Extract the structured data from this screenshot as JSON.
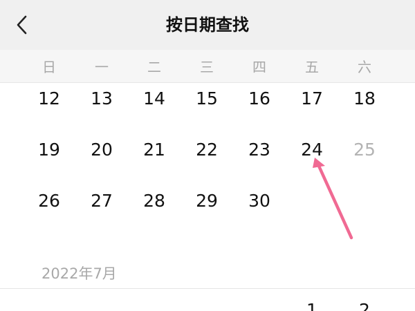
{
  "header": {
    "title": "按日期查找",
    "back_icon": "chevron-left-icon"
  },
  "weekdays": [
    "日",
    "一",
    "二",
    "三",
    "四",
    "五",
    "六"
  ],
  "calendar": {
    "rows": [
      [
        {
          "label": "12",
          "disabled": false
        },
        {
          "label": "13",
          "disabled": false
        },
        {
          "label": "14",
          "disabled": false
        },
        {
          "label": "15",
          "disabled": false
        },
        {
          "label": "16",
          "disabled": false
        },
        {
          "label": "17",
          "disabled": false
        },
        {
          "label": "18",
          "disabled": false
        }
      ],
      [
        {
          "label": "19",
          "disabled": false
        },
        {
          "label": "20",
          "disabled": false
        },
        {
          "label": "21",
          "disabled": false
        },
        {
          "label": "22",
          "disabled": false
        },
        {
          "label": "23",
          "disabled": false
        },
        {
          "label": "24",
          "disabled": false
        },
        {
          "label": "25",
          "disabled": true
        }
      ],
      [
        {
          "label": "26",
          "disabled": false
        },
        {
          "label": "27",
          "disabled": false
        },
        {
          "label": "28",
          "disabled": false
        },
        {
          "label": "29",
          "disabled": false
        },
        {
          "label": "30",
          "disabled": false
        }
      ]
    ]
  },
  "next_month": {
    "label": "2022年7月",
    "first_days": [
      "1",
      "2"
    ]
  },
  "annotation": {
    "points_to": "24",
    "color": "#f06a93"
  },
  "colors": {
    "header_bg": "#f0f0f0",
    "weekday_text": "#a8a8a8",
    "day_text": "#111111",
    "disabled_day_text": "#b3b3b3"
  }
}
